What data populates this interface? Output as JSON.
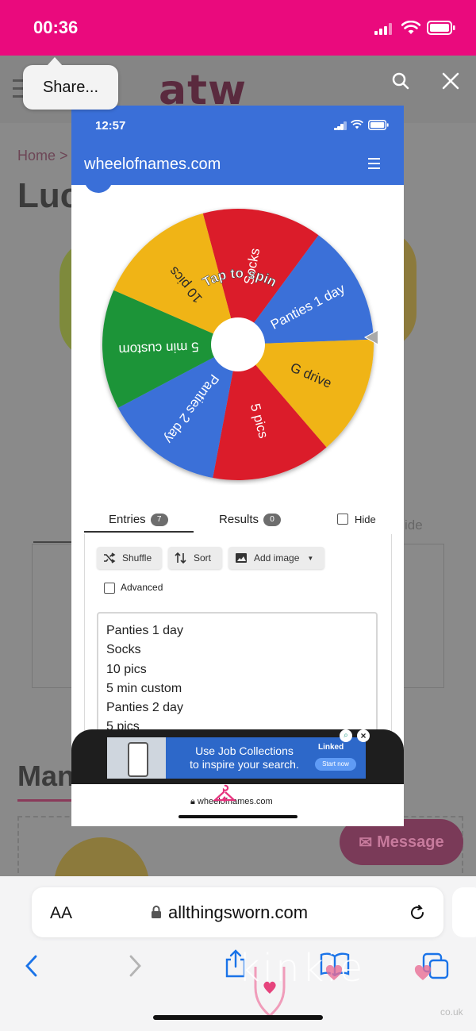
{
  "outer_status": {
    "time": "00:36",
    "bar_color": "#ea0a7d"
  },
  "tooltip": {
    "label": "Share..."
  },
  "background_page": {
    "logo": "atw",
    "breadcrumb": "Home  >",
    "title_partial": "Luc",
    "section_partial": "Man",
    "message_button": "Message",
    "hide_partial": "ide"
  },
  "inner": {
    "status_time": "12:57",
    "app_url": "wheelofnames.com",
    "wheel": {
      "center_label": "Tap to spin",
      "segments": [
        {
          "label": "Socks",
          "color": "#db1f2b"
        },
        {
          "label": "Panties 1 day",
          "color": "#3a6fd8"
        },
        {
          "label": "G drive",
          "color": "#f0b414"
        },
        {
          "label": "5 pics",
          "color": "#db1f2b"
        },
        {
          "label": "Panties 2 day",
          "color": "#3a6fd8"
        },
        {
          "label": "5 min custom",
          "color": "#1c9439"
        },
        {
          "label": "10 pics",
          "color": "#f0b414"
        }
      ]
    },
    "tabs": {
      "entries_label": "Entries",
      "entries_count": "7",
      "results_label": "Results",
      "results_count": "0",
      "hide_label": "Hide"
    },
    "toolbar": {
      "shuffle": "Shuffle",
      "sort": "Sort",
      "add_image": "Add image",
      "advanced": "Advanced"
    },
    "entries": [
      "Panties 1 day",
      "Socks",
      "10 pics",
      "5 min custom",
      "Panties 2 day",
      "5 pics"
    ],
    "ad": {
      "line1": "Use Job Collections",
      "line2": "to inspire your search.",
      "brand": "Linked",
      "cta": "Start now"
    },
    "bottom_url": "wheelofnames.com"
  },
  "safari": {
    "aa": "AA",
    "url": "allthingsworn.com"
  },
  "watermark": {
    "brand": "kinkie",
    "sub": "co.uk"
  }
}
